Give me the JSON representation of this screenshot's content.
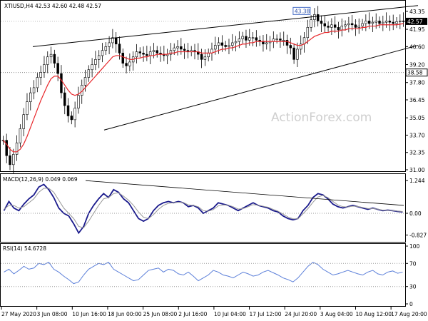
{
  "chart_data": [
    {
      "type": "candlestick",
      "header": "XTIUSD,H4  42.53 42.60 42.48 42.57",
      "symbol": "XTIUSD",
      "timeframe": "H4",
      "ohlc": {
        "open": 42.53,
        "high": 42.6,
        "low": 42.48,
        "close": 42.57
      },
      "x_ticks": [
        "27 May 2020",
        "3 Jun 08:00",
        "10 Jun 16:00",
        "18 Jun 00:00",
        "25 Jun 08:00",
        "2 Jul 16:00",
        "10 Jul 04:00",
        "17 Jul 12:00",
        "24 Jul 20:00",
        "3 Aug 04:00",
        "10 Aug 12:00",
        "17 Aug 20:00"
      ],
      "y_ticks": [
        "43.35",
        "41.95",
        "40.60",
        "39.20",
        "37.80",
        "36.45",
        "35.05",
        "33.70",
        "32.35",
        "31.00"
      ],
      "ylim": [
        31.0,
        43.9
      ],
      "price_labels": {
        "current": "42.57",
        "horizontal_line": "38.58",
        "annotation": "43.38"
      },
      "levels": {
        "horizontal_line": 38.58,
        "peak": 43.38
      },
      "closes": [
        33.3,
        32.1,
        31.4,
        32.2,
        33.1,
        34.2,
        35.3,
        36.3,
        37.0,
        37.4,
        38.2,
        38.6,
        39.2,
        39.8,
        40.0,
        39.3,
        38.5,
        37.0,
        36.0,
        35.2,
        34.9,
        35.8,
        36.8,
        37.6,
        38.2,
        38.8,
        39.2,
        39.6,
        39.9,
        40.3,
        40.6,
        40.9,
        41.3,
        40.8,
        40.1,
        39.3,
        39.1,
        39.4,
        39.8,
        40.2,
        40.1,
        40.0,
        39.9,
        40.2,
        40.3,
        40.1,
        40.0,
        39.9,
        40.0,
        40.3,
        40.5,
        40.6,
        40.4,
        40.3,
        40.2,
        40.3,
        40.2,
        40.0,
        39.6,
        39.8,
        40.1,
        40.4,
        40.7,
        40.9,
        40.7,
        40.6,
        40.7,
        40.9,
        41.0,
        41.2,
        41.4,
        41.1,
        41.3,
        41.3,
        41.1,
        41.0,
        40.8,
        40.9,
        41.0,
        41.2,
        41.2,
        41.1,
        41.1,
        40.7,
        40.5,
        39.6,
        40.4,
        40.8,
        41.3,
        42.1,
        42.7,
        43.1,
        42.6,
        42.4,
        42.2,
        42.1,
        42.3,
        42.1,
        41.9,
        42.2,
        42.3,
        42.4,
        42.3,
        42.1,
        42.2,
        42.4,
        42.6,
        42.4,
        42.5,
        42.6,
        42.4,
        42.5,
        42.6,
        42.5,
        42.4,
        42.55,
        42.6,
        42.57
      ],
      "ma_closes": [
        33.3,
        33.0,
        32.6,
        32.4,
        32.4,
        32.6,
        33.0,
        33.6,
        34.3,
        35.0,
        35.7,
        36.4,
        37.0,
        37.6,
        38.1,
        38.3,
        38.3,
        38.0,
        37.6,
        37.2,
        36.9,
        36.8,
        36.9,
        37.1,
        37.4,
        37.7,
        38.0,
        38.3,
        38.6,
        38.9,
        39.2,
        39.5,
        39.8,
        39.9,
        39.9,
        39.8,
        39.7,
        39.6,
        39.6,
        39.7,
        39.7,
        39.8,
        39.8,
        39.9,
        39.9,
        40.0,
        40.0,
        40.0,
        40.0,
        40.1,
        40.1,
        40.2,
        40.2,
        40.2,
        40.2,
        40.2,
        40.2,
        40.2,
        40.1,
        40.1,
        40.1,
        40.1,
        40.2,
        40.3,
        40.4,
        40.4,
        40.5,
        40.5,
        40.6,
        40.7,
        40.8,
        40.8,
        40.9,
        40.9,
        41.0,
        41.0,
        41.0,
        41.0,
        41.0,
        41.0,
        41.0,
        41.0,
        41.0,
        41.0,
        40.9,
        40.8,
        40.7,
        40.7,
        40.8,
        41.0,
        41.2,
        41.4,
        41.5,
        41.6,
        41.7,
        41.7,
        41.8,
        41.8,
        41.8,
        41.9,
        41.9,
        42.0,
        42.0,
        42.0,
        42.0,
        42.1,
        42.1,
        42.2,
        42.2,
        42.2,
        42.3,
        42.3,
        42.3,
        42.3,
        42.3,
        42.3,
        42.35,
        42.4
      ],
      "trendlines": [
        {
          "name": "upper channel",
          "from": [
            "27 May 2020",
            40.6
          ],
          "to": [
            "17 Aug 20:00",
            43.8
          ]
        },
        {
          "name": "lower channel",
          "from": [
            "10 Jun 16:00",
            34.1
          ],
          "to": [
            "17 Aug 20:00",
            40.7
          ]
        }
      ]
    },
    {
      "type": "line",
      "label": "MACD(12,26,9) 0.049 0.069",
      "indicator": "MACD",
      "params": [
        12,
        26,
        9
      ],
      "values_shown": [
        0.049,
        0.069
      ],
      "y_ticks": [
        "1.244",
        "0.00",
        "-0.827"
      ],
      "ylim": [
        -0.95,
        1.33
      ],
      "series": [
        {
          "name": "MACD",
          "values": [
            0.1,
            0.45,
            0.2,
            0.1,
            0.35,
            0.55,
            0.7,
            1.0,
            1.1,
            0.9,
            0.6,
            0.2,
            0.0,
            -0.1,
            -0.4,
            -0.75,
            -0.5,
            0.0,
            0.3,
            0.55,
            0.75,
            0.6,
            0.9,
            0.8,
            0.55,
            0.4,
            0.1,
            -0.2,
            -0.3,
            -0.2,
            0.1,
            0.3,
            0.4,
            0.45,
            0.4,
            0.45,
            0.4,
            0.25,
            0.3,
            0.2,
            0.0,
            0.1,
            0.2,
            0.4,
            0.35,
            0.3,
            0.2,
            0.1,
            0.2,
            0.3,
            0.4,
            0.3,
            0.25,
            0.2,
            0.1,
            0.05,
            -0.1,
            -0.2,
            -0.25,
            -0.2,
            0.1,
            0.3,
            0.6,
            0.75,
            0.7,
            0.55,
            0.35,
            0.25,
            0.2,
            0.25,
            0.3,
            0.25,
            0.2,
            0.15,
            0.2,
            0.15,
            0.1,
            0.12,
            0.1,
            0.07,
            0.05
          ]
        },
        {
          "name": "Signal",
          "values": [
            0.15,
            0.3,
            0.3,
            0.2,
            0.25,
            0.4,
            0.55,
            0.8,
            0.95,
            0.95,
            0.8,
            0.5,
            0.2,
            0.0,
            -0.2,
            -0.5,
            -0.55,
            -0.3,
            0.0,
            0.3,
            0.55,
            0.6,
            0.75,
            0.78,
            0.65,
            0.5,
            0.3,
            0.05,
            -0.15,
            -0.2,
            -0.05,
            0.15,
            0.3,
            0.38,
            0.4,
            0.42,
            0.41,
            0.32,
            0.3,
            0.25,
            0.1,
            0.08,
            0.14,
            0.28,
            0.32,
            0.31,
            0.25,
            0.16,
            0.18,
            0.25,
            0.33,
            0.31,
            0.27,
            0.23,
            0.15,
            0.08,
            -0.03,
            -0.14,
            -0.21,
            -0.21,
            -0.02,
            0.18,
            0.42,
            0.62,
            0.68,
            0.6,
            0.45,
            0.32,
            0.25,
            0.24,
            0.27,
            0.26,
            0.22,
            0.18,
            0.18,
            0.16,
            0.12,
            0.11,
            0.1,
            0.08,
            0.069
          ]
        }
      ]
    },
    {
      "type": "line",
      "label": "RSI(14) 54.6728",
      "indicator": "RSI",
      "period": 14,
      "value_shown": 54.6728,
      "y_ticks": [
        "100",
        "70",
        "30",
        "0"
      ],
      "ylim": [
        0,
        100
      ],
      "levels": [
        70,
        30
      ],
      "series": [
        {
          "name": "RSI",
          "values": [
            55,
            60,
            52,
            58,
            65,
            60,
            62,
            70,
            68,
            72,
            60,
            55,
            48,
            42,
            35,
            38,
            50,
            60,
            65,
            70,
            68,
            72,
            60,
            55,
            50,
            45,
            40,
            42,
            50,
            58,
            60,
            62,
            55,
            60,
            58,
            52,
            50,
            55,
            48,
            40,
            45,
            50,
            58,
            55,
            50,
            48,
            45,
            50,
            55,
            52,
            48,
            50,
            55,
            58,
            54,
            50,
            45,
            42,
            38,
            45,
            55,
            65,
            72,
            68,
            60,
            55,
            50,
            52,
            55,
            58,
            55,
            52,
            50,
            55,
            58,
            52,
            50,
            55,
            57,
            53,
            55
          ]
        }
      ]
    }
  ],
  "watermark": "ActionForex.com"
}
